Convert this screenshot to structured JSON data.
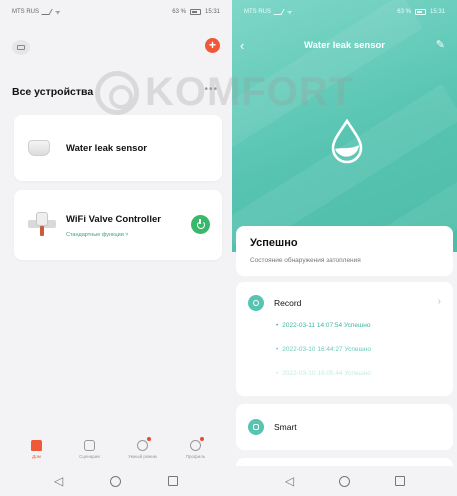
{
  "left": {
    "status": {
      "carrier": "MTS RUS",
      "battery": "63 %",
      "time": "15:31"
    },
    "section_title": "Все устройства",
    "more_icon": "more-horizontal-icon",
    "devices": [
      {
        "name": "Water leak sensor",
        "icon": "leak-sensor-icon"
      },
      {
        "name": "WiFi Valve Controller",
        "subtitle": "Стандартные функции ˅",
        "icon": "valve-icon",
        "power_color": "#39b86b"
      }
    ],
    "tabs": [
      {
        "label": "Дом",
        "icon": "home-icon",
        "active": true
      },
      {
        "label": "Сценарии",
        "icon": "scenes-icon",
        "active": false
      },
      {
        "label": "Умный режим",
        "icon": "smart-icon",
        "active": false
      },
      {
        "label": "Профиль",
        "icon": "profile-icon",
        "active": false
      }
    ],
    "accent": "#f0583a"
  },
  "watermark": {
    "text": "KOMFORT"
  },
  "right": {
    "status": {
      "carrier": "MTS RUS",
      "battery": "63 %",
      "time": "15:31"
    },
    "title": "Water leak sensor",
    "header_color": "#57c4b1",
    "status_main": "Успешно",
    "status_sub": "Состояние обнаружения затопления",
    "record_label": "Record",
    "records": [
      "2022-03-11 14:07:54 Успешно",
      "2022-03-10 16:44:27 Успешно",
      "2022-03-10 16:05:44 Успешно"
    ],
    "smart_label": "Smart"
  }
}
